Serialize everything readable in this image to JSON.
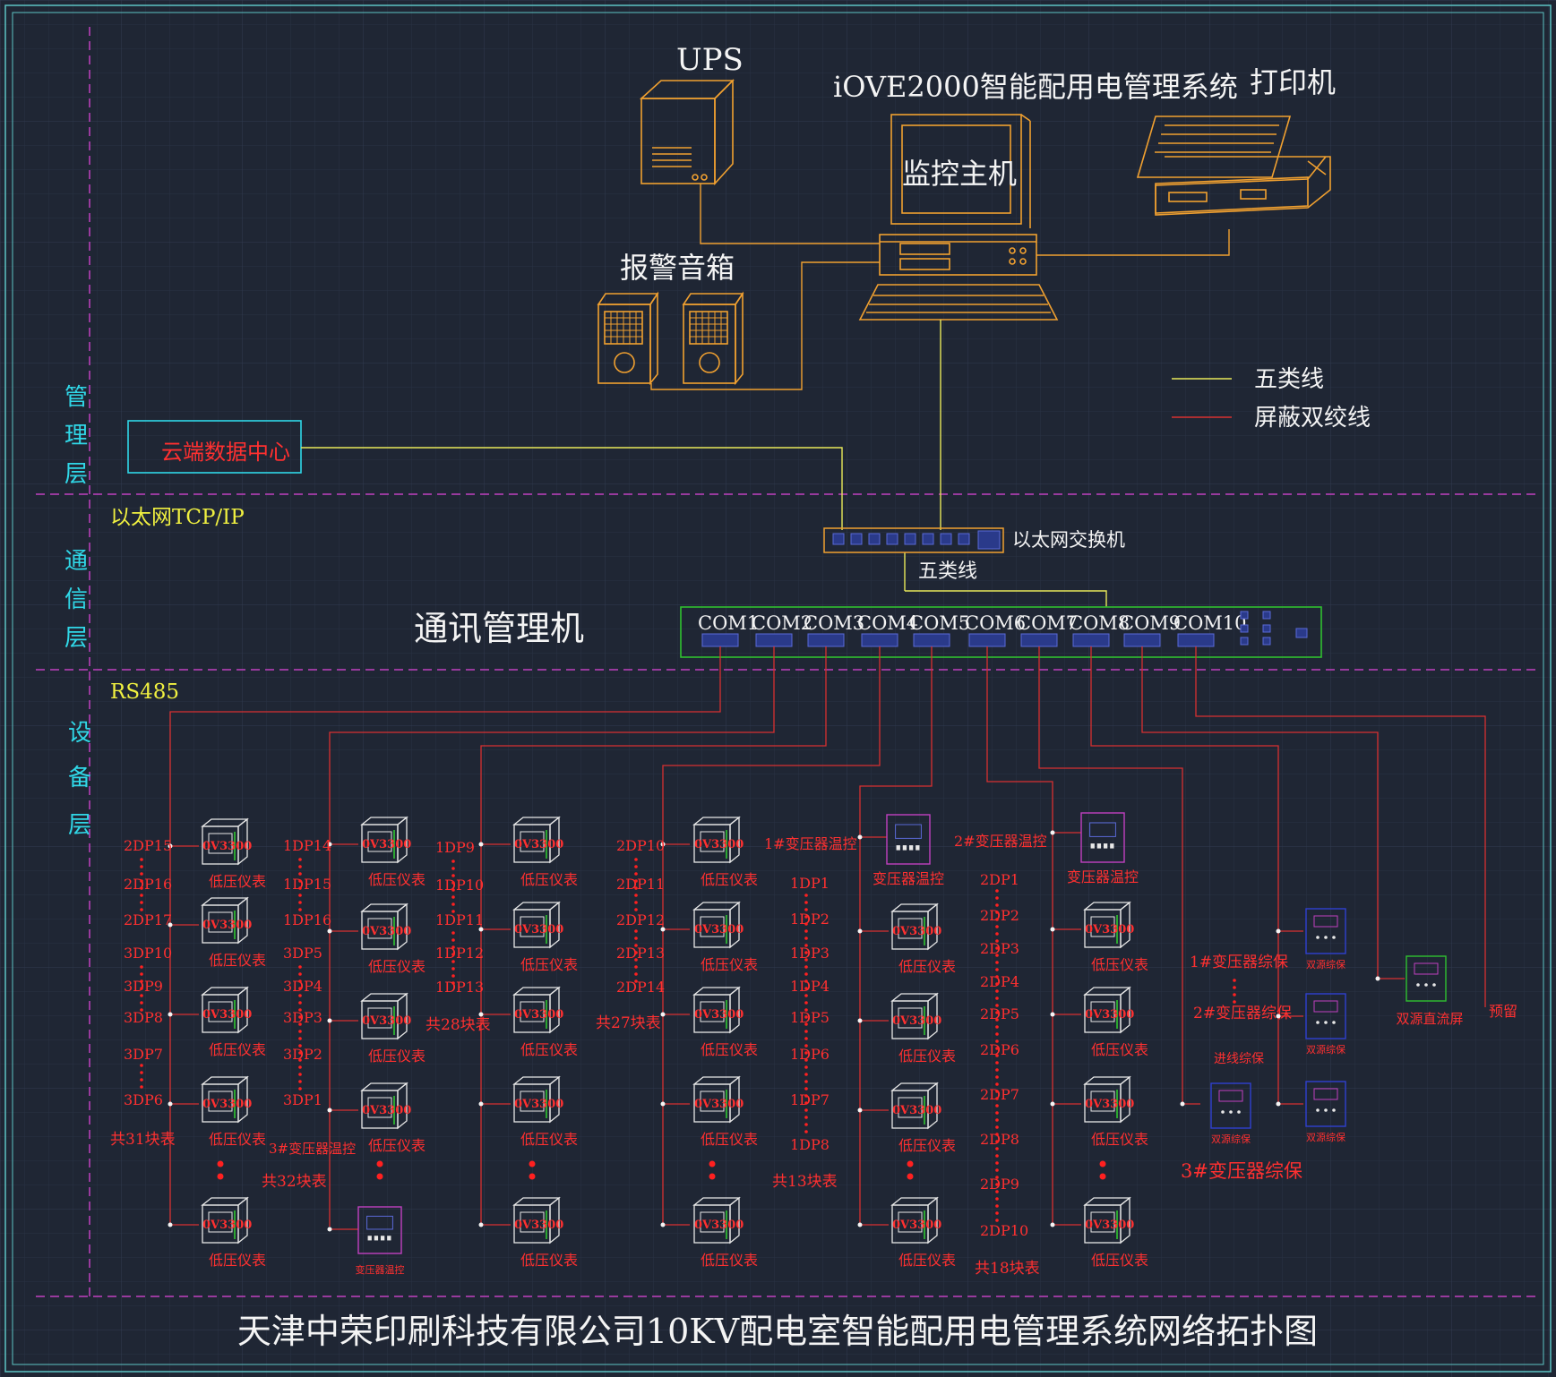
{
  "title": "天津中荣印刷科技有限公司10KV配电室智能配用电管理系统网络拓扑图",
  "layers": {
    "management": [
      "管",
      "理",
      "层"
    ],
    "communication": [
      "通",
      "信",
      "层"
    ],
    "device": [
      "设",
      "备",
      "层"
    ]
  },
  "top": {
    "ups_label": "UPS",
    "system_label": "iOVE2000智能配用电管理系统",
    "monitor_label": "监控主机",
    "printer_label": "打印机",
    "speaker_label": "报警音箱",
    "cloud_label": "云端数据中心"
  },
  "legend": {
    "cat5": "五类线",
    "twisted": "屏蔽双绞线",
    "cat5_color": "#e8e85a",
    "twisted_color": "#d83030"
  },
  "network": {
    "ethernet_label": "以太网TCP/IP",
    "switch_label": "以太网交换机",
    "cat5_label": "五类线",
    "comm_label": "通讯管理机",
    "rs485_label": "RS485",
    "com_ports": [
      "COM1",
      "COM2",
      "COM3",
      "COM4",
      "COM5",
      "COM6",
      "COM7",
      "COM8",
      "COM9",
      "COM10"
    ]
  },
  "devices": {
    "meter_code": "0V3300",
    "meter_label": "低压仪表",
    "transformer_temp": "变压器温控",
    "transformer_temp_small": "变压器温控",
    "col1": {
      "labels": [
        "2DP15",
        "2DP16",
        "2DP17",
        "3DP10",
        "3DP9",
        "3DP8",
        "3DP7",
        "3DP6"
      ],
      "count": "共31块表"
    },
    "col2": {
      "labels": [
        "1DP14",
        "1DP15",
        "1DP16",
        "3DP5",
        "3DP4",
        "3DP3",
        "3DP2",
        "3DP1"
      ],
      "sub": "3#变压器温控",
      "count": "共32块表"
    },
    "col3": {
      "labels": [
        "1DP9",
        "1DP10",
        "1DP11",
        "1DP12",
        "1DP13"
      ],
      "count": "共28块表"
    },
    "col4": {
      "labels": [
        "2DP10",
        "2DP11",
        "2DP12",
        "2DP13",
        "2DP14"
      ],
      "count": "共27块表"
    },
    "col5": {
      "header": "1#变压器温控",
      "labels": [
        "1DP1",
        "1DP2",
        "1DP3",
        "1DP4",
        "1DP5",
        "1DP6",
        "1DP7",
        "1DP8"
      ],
      "count": "共13块表"
    },
    "col6": {
      "header": "2#变压器温控",
      "labels": [
        "2DP1",
        "2DP2",
        "2DP3",
        "2DP4",
        "2DP5",
        "2DP6",
        "2DP7",
        "2DP8",
        "2DP9",
        "2DP10"
      ],
      "count": "共18块表"
    },
    "protection": {
      "t1": "1#变压器综保",
      "t2": "2#变压器综保",
      "inlet": "进线综保",
      "t3": "3#变压器综保",
      "dual": "双源综保",
      "dc_screen": "双源直流屏",
      "reserved": "预留"
    }
  }
}
